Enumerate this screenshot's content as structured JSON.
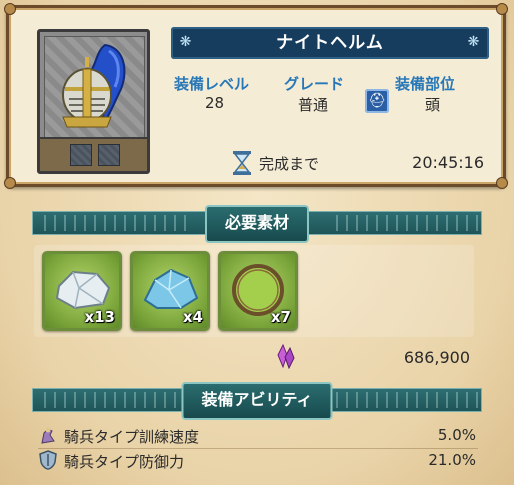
{
  "item": {
    "name": "ナイトヘルム",
    "stats": {
      "level_label": "装備レベル",
      "level_value": "28",
      "grade_label": "グレード",
      "grade_value": "普通",
      "part_label": "装備部位",
      "part_value": "頭"
    },
    "timer": {
      "label": "完成まで",
      "value": "20:45:16"
    }
  },
  "materials_section": {
    "title": "必要素材",
    "items": [
      {
        "icon": "silver-ore-icon",
        "quantity": "x13"
      },
      {
        "icon": "crystal-ore-icon",
        "quantity": "x4"
      },
      {
        "icon": "wreath-icon",
        "quantity": "x7"
      }
    ],
    "cost": {
      "icon": "crystal-currency-icon",
      "value": "686,900"
    }
  },
  "abilities_section": {
    "title": "装備アビリティ",
    "rows": [
      {
        "icon": "cavalry-training-icon",
        "label": "騎兵タイプ訓練速度",
        "value": "5.0%"
      },
      {
        "icon": "cavalry-defense-icon",
        "label": "騎兵タイプ防御力",
        "value": "21.0%"
      }
    ]
  },
  "colors": {
    "banner_blue": "#173d5e",
    "section_teal": "#1d5356",
    "stat_label_blue": "#2878b8",
    "material_green": "#7aa53a"
  }
}
